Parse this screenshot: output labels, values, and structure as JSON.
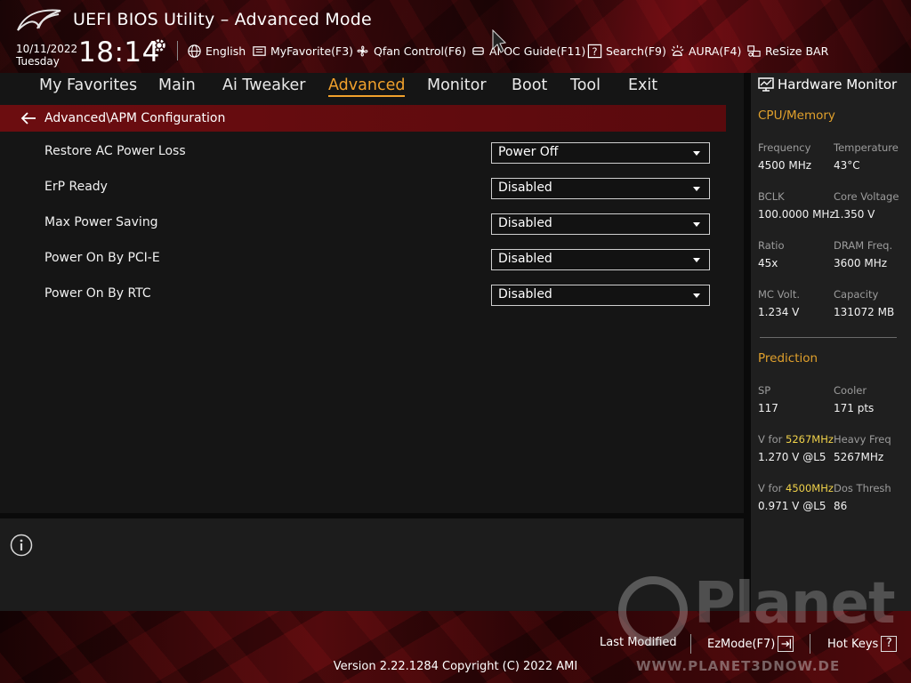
{
  "header": {
    "title": "UEFI BIOS Utility – Advanced Mode",
    "date": "10/11/2022",
    "day": "Tuesday",
    "time": "18:14",
    "toolbar": [
      {
        "label": "English",
        "icon": "globe-icon"
      },
      {
        "label": "MyFavorite(F3)",
        "icon": "favorite-list-icon"
      },
      {
        "label": "Qfan Control(F6)",
        "icon": "fan-icon"
      },
      {
        "label": "AI OC Guide(F11)",
        "icon": "ai-chip-icon"
      },
      {
        "label": "Search(F9)",
        "icon": "search-question-icon"
      },
      {
        "label": "AURA(F4)",
        "icon": "aura-light-icon"
      },
      {
        "label": "ReSize BAR",
        "icon": "resize-bar-icon"
      }
    ]
  },
  "menu": {
    "items": [
      "My Favorites",
      "Main",
      "Ai Tweaker",
      "Advanced",
      "Monitor",
      "Boot",
      "Tool",
      "Exit"
    ],
    "active": "Advanced"
  },
  "breadcrumb": "Advanced\\APM Configuration",
  "settings": [
    {
      "label": "Restore AC Power Loss",
      "value": "Power Off"
    },
    {
      "label": "ErP Ready",
      "value": "Disabled"
    },
    {
      "label": "Max Power Saving",
      "value": "Disabled"
    },
    {
      "label": "Power On By PCI-E",
      "value": "Disabled"
    },
    {
      "label": "Power On By RTC",
      "value": "Disabled"
    }
  ],
  "hardware_monitor": {
    "title": "Hardware Monitor",
    "cpu_memory": {
      "title": "CPU/Memory",
      "items": [
        {
          "label": "Frequency",
          "value": "4500 MHz"
        },
        {
          "label": "Temperature",
          "value": "43°C"
        },
        {
          "label": "BCLK",
          "value": "100.0000 MHz"
        },
        {
          "label": "Core Voltage",
          "value": "1.350 V"
        },
        {
          "label": "Ratio",
          "value": "45x"
        },
        {
          "label": "DRAM Freq.",
          "value": "3600 MHz"
        },
        {
          "label": "MC Volt.",
          "value": "1.234 V"
        },
        {
          "label": "Capacity",
          "value": "131072 MB"
        }
      ]
    },
    "prediction": {
      "title": "Prediction",
      "sp_label": "SP",
      "sp_value": "117",
      "cooler_label": "Cooler",
      "cooler_value": "171 pts",
      "v1_prefix": "V for ",
      "v1_freq": "5267MHz",
      "v1_value": "1.270 V @L5",
      "heavy_label": "Heavy Freq",
      "heavy_value": "5267MHz",
      "v2_prefix": "V for ",
      "v2_freq": "4500MHz",
      "v2_value": "0.971 V @L5",
      "dos_label": "Dos Thresh",
      "dos_value": "86"
    }
  },
  "footer": {
    "last_modified": "Last Modified",
    "ezmode": "EzMode(F7)",
    "hotkeys": "Hot Keys",
    "hotkeys_key": "?",
    "version": "Version 2.22.1284 Copyright (C) 2022 AMI"
  },
  "watermark": {
    "brand": "Planet",
    "url": "WWW.PLANET3DNOW.DE"
  },
  "colors": {
    "accent": "#f1a12c",
    "breadcrumb_bg": "#6c0d10",
    "highlight": "#f0d24a"
  }
}
